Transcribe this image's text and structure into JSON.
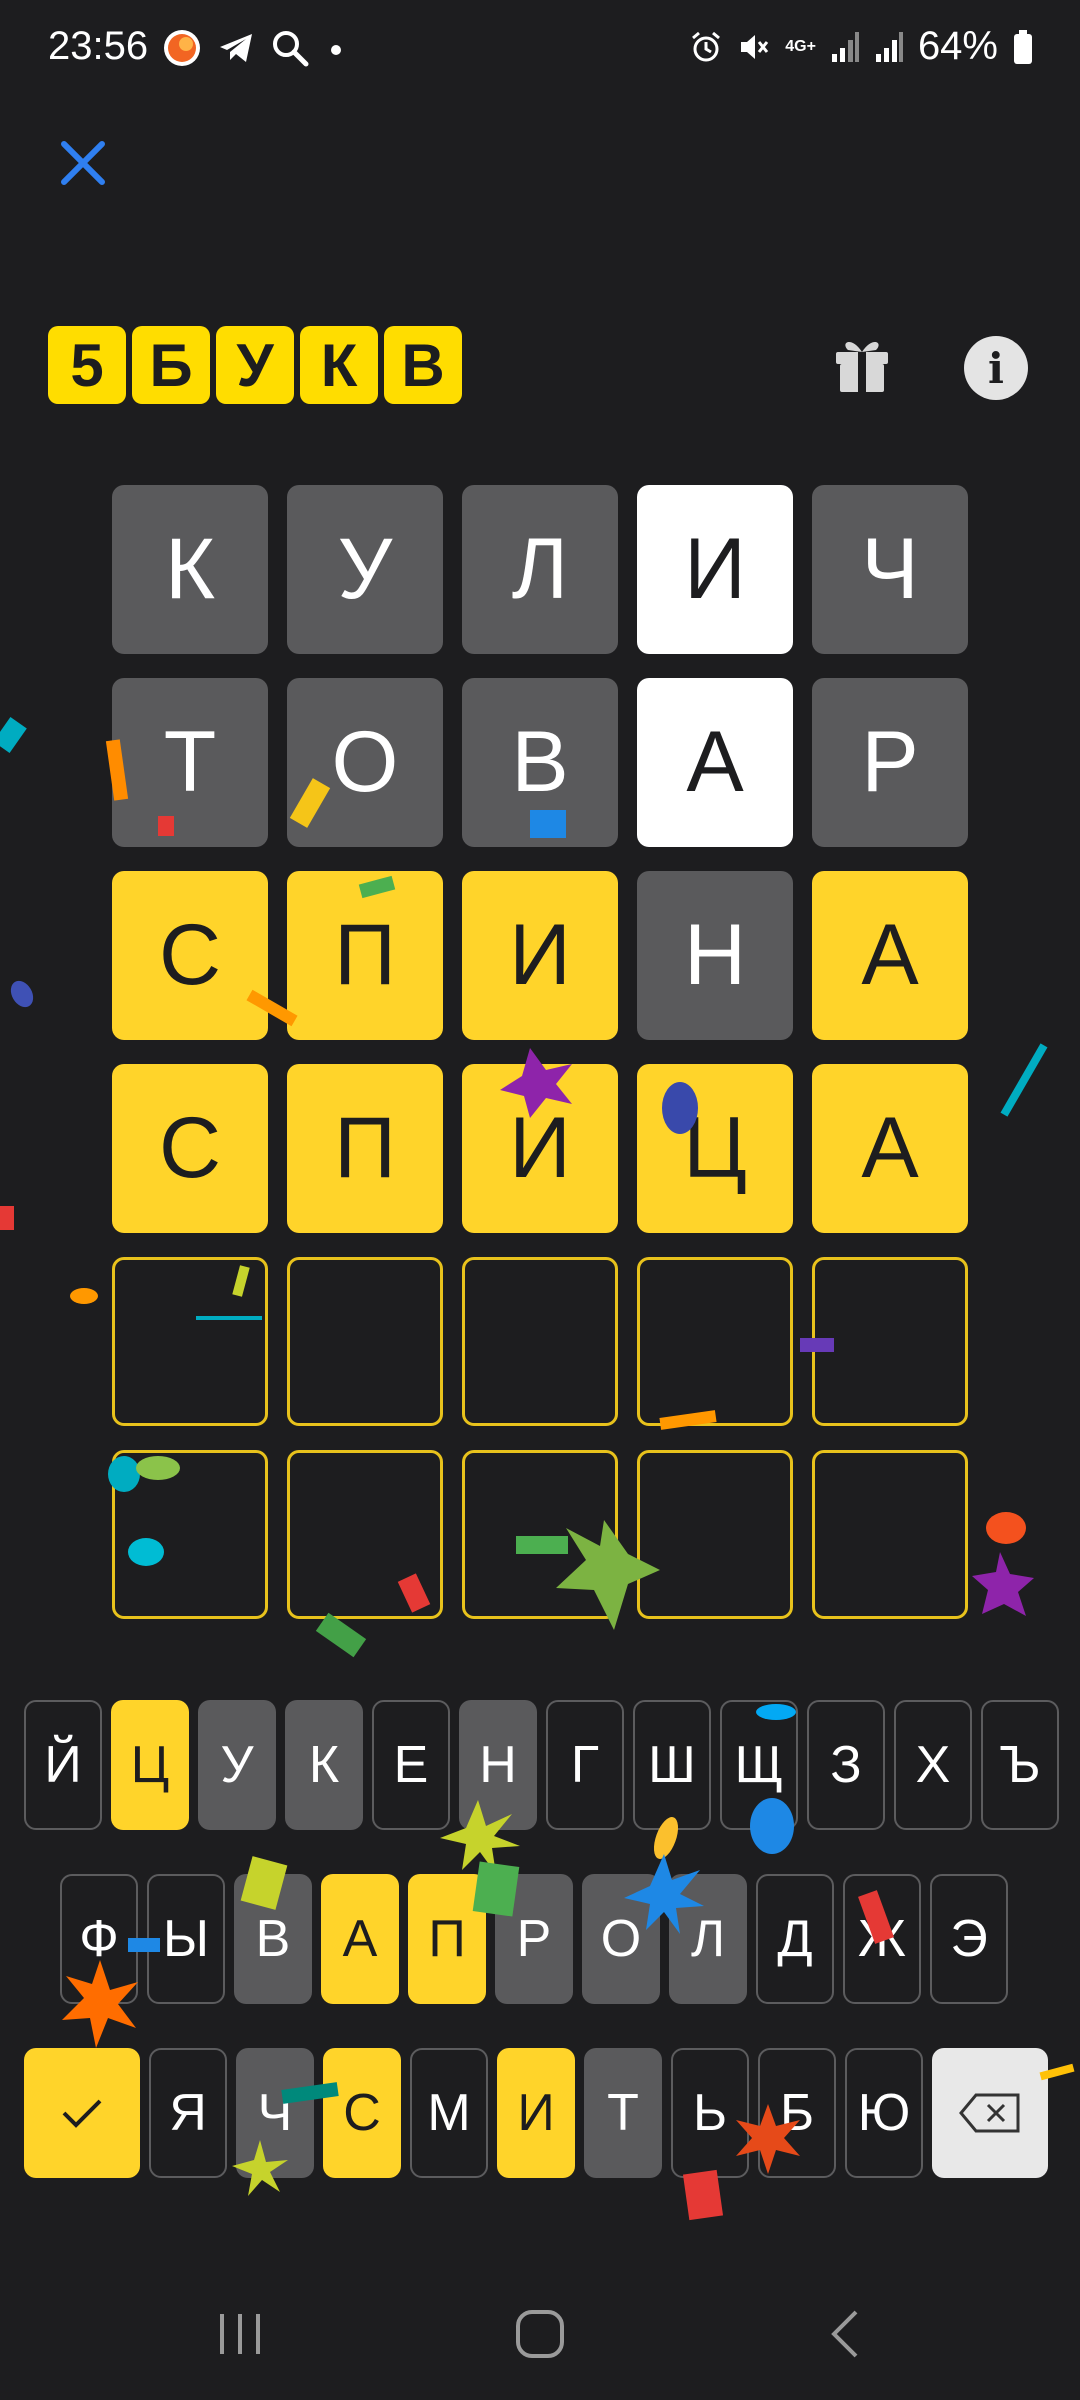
{
  "status_bar": {
    "time": "23:56",
    "battery": "64%",
    "network": "4G+"
  },
  "icons": {
    "close": "close-icon",
    "gift": "gift-icon",
    "info": "info-icon",
    "enter": "checkmark-icon",
    "backspace": "backspace-icon"
  },
  "game": {
    "logo_letters": [
      "5",
      "Б",
      "У",
      "К",
      "В"
    ],
    "grid": [
      [
        {
          "letter": "К",
          "state": "absent"
        },
        {
          "letter": "У",
          "state": "absent"
        },
        {
          "letter": "Л",
          "state": "absent"
        },
        {
          "letter": "И",
          "state": "present"
        },
        {
          "letter": "Ч",
          "state": "absent"
        }
      ],
      [
        {
          "letter": "Т",
          "state": "absent"
        },
        {
          "letter": "О",
          "state": "absent"
        },
        {
          "letter": "В",
          "state": "absent"
        },
        {
          "letter": "А",
          "state": "present"
        },
        {
          "letter": "Р",
          "state": "absent"
        }
      ],
      [
        {
          "letter": "С",
          "state": "correct"
        },
        {
          "letter": "П",
          "state": "correct"
        },
        {
          "letter": "И",
          "state": "correct"
        },
        {
          "letter": "Н",
          "state": "absent"
        },
        {
          "letter": "А",
          "state": "correct"
        }
      ],
      [
        {
          "letter": "С",
          "state": "correct"
        },
        {
          "letter": "П",
          "state": "correct"
        },
        {
          "letter": "И",
          "state": "correct"
        },
        {
          "letter": "Ц",
          "state": "correct"
        },
        {
          "letter": "А",
          "state": "correct"
        }
      ],
      [
        {
          "letter": "",
          "state": "empty"
        },
        {
          "letter": "",
          "state": "empty"
        },
        {
          "letter": "",
          "state": "empty"
        },
        {
          "letter": "",
          "state": "empty"
        },
        {
          "letter": "",
          "state": "empty"
        }
      ],
      [
        {
          "letter": "",
          "state": "empty"
        },
        {
          "letter": "",
          "state": "empty"
        },
        {
          "letter": "",
          "state": "empty"
        },
        {
          "letter": "",
          "state": "empty"
        },
        {
          "letter": "",
          "state": "empty"
        }
      ]
    ]
  },
  "keyboard": {
    "row1": [
      {
        "label": "Й",
        "state": "unused"
      },
      {
        "label": "Ц",
        "state": "correct"
      },
      {
        "label": "У",
        "state": "absent"
      },
      {
        "label": "К",
        "state": "absent"
      },
      {
        "label": "Е",
        "state": "unused"
      },
      {
        "label": "Н",
        "state": "absent"
      },
      {
        "label": "Г",
        "state": "unused"
      },
      {
        "label": "Ш",
        "state": "unused"
      },
      {
        "label": "Щ",
        "state": "unused"
      },
      {
        "label": "З",
        "state": "unused"
      },
      {
        "label": "Х",
        "state": "unused"
      },
      {
        "label": "Ъ",
        "state": "unused"
      }
    ],
    "row2": [
      {
        "label": "Ф",
        "state": "unused"
      },
      {
        "label": "Ы",
        "state": "unused"
      },
      {
        "label": "В",
        "state": "absent"
      },
      {
        "label": "А",
        "state": "correct"
      },
      {
        "label": "П",
        "state": "correct"
      },
      {
        "label": "Р",
        "state": "absent"
      },
      {
        "label": "О",
        "state": "absent"
      },
      {
        "label": "Л",
        "state": "absent"
      },
      {
        "label": "Д",
        "state": "unused"
      },
      {
        "label": "Ж",
        "state": "unused"
      },
      {
        "label": "Э",
        "state": "unused"
      }
    ],
    "row3": [
      {
        "label": "Я",
        "state": "unused"
      },
      {
        "label": "Ч",
        "state": "absent"
      },
      {
        "label": "С",
        "state": "correct"
      },
      {
        "label": "М",
        "state": "unused"
      },
      {
        "label": "И",
        "state": "correct"
      },
      {
        "label": "Т",
        "state": "absent"
      },
      {
        "label": "Ь",
        "state": "unused"
      },
      {
        "label": "Б",
        "state": "unused"
      },
      {
        "label": "Ю",
        "state": "unused"
      }
    ]
  },
  "colors": {
    "background": "#1d1d1f",
    "correct": "#ffd42a",
    "present": "#ffffff",
    "absent": "#5a5a5c",
    "close_icon": "#2f7ff0"
  }
}
